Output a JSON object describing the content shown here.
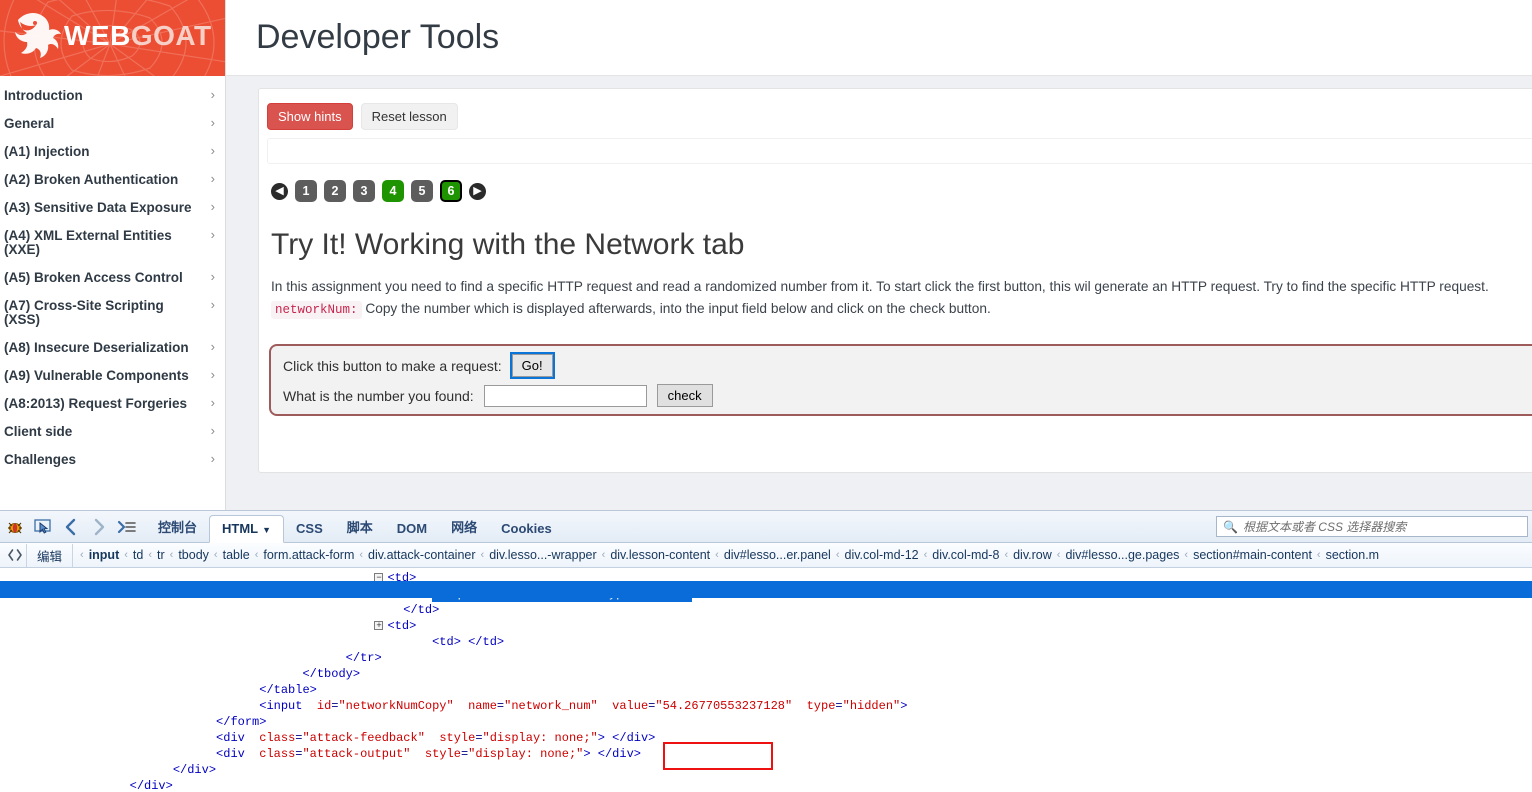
{
  "brand": {
    "name_part1": "WEB",
    "name_part2": "GOAT"
  },
  "sidebar": {
    "items": [
      {
        "label": "Introduction",
        "chevron": "›"
      },
      {
        "label": "General",
        "chevron": "›"
      },
      {
        "label": "(A1) Injection",
        "chevron": "›"
      },
      {
        "label": "(A2) Broken Authentication",
        "chevron": "›"
      },
      {
        "label": "(A3) Sensitive Data Exposure",
        "chevron": "›"
      },
      {
        "label": "(A4) XML External Entities (XXE)",
        "chevron": "›"
      },
      {
        "label": "(A5) Broken Access Control",
        "chevron": "›"
      },
      {
        "label": "(A7) Cross-Site Scripting (XSS)",
        "chevron": "›"
      },
      {
        "label": "(A8) Insecure Deserialization",
        "chevron": "›"
      },
      {
        "label": "(A9) Vulnerable Components",
        "chevron": "›"
      },
      {
        "label": "(A8:2013) Request Forgeries",
        "chevron": "›"
      },
      {
        "label": "Client side",
        "chevron": "›"
      },
      {
        "label": "Challenges",
        "chevron": "›"
      }
    ]
  },
  "header": {
    "title": "Developer Tools"
  },
  "lesson": {
    "show_hints_label": "Show hints",
    "reset_lesson_label": "Reset lesson",
    "pagination": {
      "prev_glyph": "◀",
      "next_glyph": "▶",
      "pages": [
        {
          "label": "1",
          "state": "gray"
        },
        {
          "label": "2",
          "state": "gray"
        },
        {
          "label": "3",
          "state": "gray"
        },
        {
          "label": "4",
          "state": "green"
        },
        {
          "label": "5",
          "state": "gray"
        },
        {
          "label": "6",
          "state": "active"
        }
      ]
    },
    "title": "Try It! Working with the Network tab",
    "desc_line1": "In this assignment you need to find a specific HTTP request and read a randomized number from it. To start click the first button, this wil generate an HTTP request. Try to find the specific HTTP request. ",
    "code_token": "networkNum:",
    "desc_line2": "Copy the number which is displayed afterwards, into the input field below and click on the check button.",
    "form": {
      "request_label": "Click this button to make a request:",
      "go_label": "Go!",
      "number_label": "What is the number you found:",
      "number_value": "",
      "number_placeholder": "",
      "check_label": "check"
    }
  },
  "devtools": {
    "icons": {
      "firebug": "firebug-bug-icon",
      "inspect": "inspect-element-icon",
      "back": "❮",
      "forward": "❯",
      "panel_menu": "❯☰"
    },
    "tabs": [
      {
        "label": "控制台",
        "active": false,
        "dropdown": false
      },
      {
        "label": "HTML",
        "active": true,
        "dropdown": true
      },
      {
        "label": "CSS",
        "active": false,
        "dropdown": false
      },
      {
        "label": "脚本",
        "active": false,
        "dropdown": false
      },
      {
        "label": "DOM",
        "active": false,
        "dropdown": false
      },
      {
        "label": "网络",
        "active": false,
        "dropdown": false
      },
      {
        "label": "Cookies",
        "active": false,
        "dropdown": false
      }
    ],
    "search": {
      "placeholder": "根据文本或者 CSS 选择器搜索",
      "value": ""
    },
    "crumbbar": {
      "edit_label": "编辑",
      "lead_sep": "‹",
      "separator": "‹",
      "items": [
        "input",
        "td",
        "tr",
        "tbody",
        "table",
        "form.attack-form",
        "div.attack-container",
        "div.lesso...-wrapper",
        "div.lesson-content",
        "div#lesso...er.panel",
        "div.col-md-12",
        "div.col-md-8",
        "div.row",
        "div#lesso...ge.pages",
        "section#main-content",
        "section.m"
      ]
    },
    "code_lines": [
      {
        "indent": 26,
        "twisty": "−",
        "text": "<td>"
      },
      {
        "indent": 30,
        "twisty": "",
        "text": "<input  name=\"number\"  type=\"text\">",
        "selected": true
      },
      {
        "indent": 28,
        "twisty": "",
        "text": "</td>"
      },
      {
        "indent": 26,
        "twisty": "+",
        "text": "<td>"
      },
      {
        "indent": 30,
        "twisty": "",
        "text": "<td> </td>"
      },
      {
        "indent": 24,
        "twisty": "",
        "text": "</tr>"
      },
      {
        "indent": 21,
        "twisty": "",
        "text": "</tbody>"
      },
      {
        "indent": 18,
        "twisty": "",
        "text": "</table>"
      },
      {
        "indent": 18,
        "twisty": "",
        "text": "<input  id=\"networkNumCopy\"  name=\"network_num\"  value=\"54.26770553237128\"  type=\"hidden\">"
      },
      {
        "indent": 15,
        "twisty": "",
        "text": "</form>"
      },
      {
        "indent": 15,
        "twisty": "",
        "text": "<div  class=\"attack-feedback\"  style=\"display: none;\"> </div>"
      },
      {
        "indent": 15,
        "twisty": "",
        "text": "<div  class=\"attack-output\"  style=\"display: none;\"> </div>"
      },
      {
        "indent": 12,
        "twisty": "",
        "text": "</div>"
      },
      {
        "indent": 9,
        "twisty": "",
        "text": "</div>"
      }
    ],
    "annotation": {
      "highlighted_value": "54.26770553237128",
      "color": "#ee1111"
    }
  },
  "colors": {
    "brand_red": "#ec4e33",
    "hint_red": "#d9534f",
    "page_green": "#1e9400",
    "selection_blue": "#0a6cd8",
    "annotation_red": "#ee1111"
  }
}
